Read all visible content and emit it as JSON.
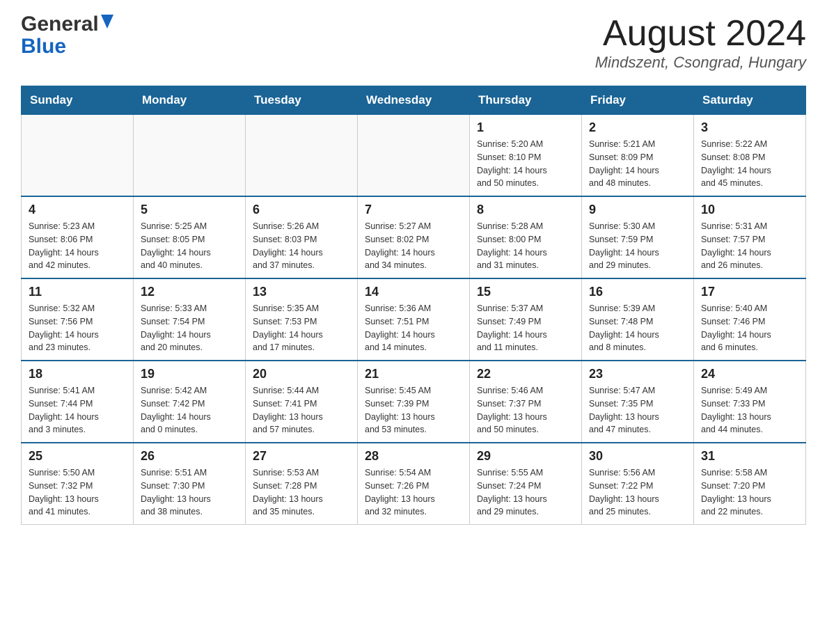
{
  "header": {
    "logo_general": "General",
    "logo_blue": "Blue",
    "month_title": "August 2024",
    "location": "Mindszent, Csongrad, Hungary"
  },
  "days_of_week": [
    "Sunday",
    "Monday",
    "Tuesday",
    "Wednesday",
    "Thursday",
    "Friday",
    "Saturday"
  ],
  "weeks": [
    [
      {
        "day": "",
        "info": ""
      },
      {
        "day": "",
        "info": ""
      },
      {
        "day": "",
        "info": ""
      },
      {
        "day": "",
        "info": ""
      },
      {
        "day": "1",
        "info": "Sunrise: 5:20 AM\nSunset: 8:10 PM\nDaylight: 14 hours\nand 50 minutes."
      },
      {
        "day": "2",
        "info": "Sunrise: 5:21 AM\nSunset: 8:09 PM\nDaylight: 14 hours\nand 48 minutes."
      },
      {
        "day": "3",
        "info": "Sunrise: 5:22 AM\nSunset: 8:08 PM\nDaylight: 14 hours\nand 45 minutes."
      }
    ],
    [
      {
        "day": "4",
        "info": "Sunrise: 5:23 AM\nSunset: 8:06 PM\nDaylight: 14 hours\nand 42 minutes."
      },
      {
        "day": "5",
        "info": "Sunrise: 5:25 AM\nSunset: 8:05 PM\nDaylight: 14 hours\nand 40 minutes."
      },
      {
        "day": "6",
        "info": "Sunrise: 5:26 AM\nSunset: 8:03 PM\nDaylight: 14 hours\nand 37 minutes."
      },
      {
        "day": "7",
        "info": "Sunrise: 5:27 AM\nSunset: 8:02 PM\nDaylight: 14 hours\nand 34 minutes."
      },
      {
        "day": "8",
        "info": "Sunrise: 5:28 AM\nSunset: 8:00 PM\nDaylight: 14 hours\nand 31 minutes."
      },
      {
        "day": "9",
        "info": "Sunrise: 5:30 AM\nSunset: 7:59 PM\nDaylight: 14 hours\nand 29 minutes."
      },
      {
        "day": "10",
        "info": "Sunrise: 5:31 AM\nSunset: 7:57 PM\nDaylight: 14 hours\nand 26 minutes."
      }
    ],
    [
      {
        "day": "11",
        "info": "Sunrise: 5:32 AM\nSunset: 7:56 PM\nDaylight: 14 hours\nand 23 minutes."
      },
      {
        "day": "12",
        "info": "Sunrise: 5:33 AM\nSunset: 7:54 PM\nDaylight: 14 hours\nand 20 minutes."
      },
      {
        "day": "13",
        "info": "Sunrise: 5:35 AM\nSunset: 7:53 PM\nDaylight: 14 hours\nand 17 minutes."
      },
      {
        "day": "14",
        "info": "Sunrise: 5:36 AM\nSunset: 7:51 PM\nDaylight: 14 hours\nand 14 minutes."
      },
      {
        "day": "15",
        "info": "Sunrise: 5:37 AM\nSunset: 7:49 PM\nDaylight: 14 hours\nand 11 minutes."
      },
      {
        "day": "16",
        "info": "Sunrise: 5:39 AM\nSunset: 7:48 PM\nDaylight: 14 hours\nand 8 minutes."
      },
      {
        "day": "17",
        "info": "Sunrise: 5:40 AM\nSunset: 7:46 PM\nDaylight: 14 hours\nand 6 minutes."
      }
    ],
    [
      {
        "day": "18",
        "info": "Sunrise: 5:41 AM\nSunset: 7:44 PM\nDaylight: 14 hours\nand 3 minutes."
      },
      {
        "day": "19",
        "info": "Sunrise: 5:42 AM\nSunset: 7:42 PM\nDaylight: 14 hours\nand 0 minutes."
      },
      {
        "day": "20",
        "info": "Sunrise: 5:44 AM\nSunset: 7:41 PM\nDaylight: 13 hours\nand 57 minutes."
      },
      {
        "day": "21",
        "info": "Sunrise: 5:45 AM\nSunset: 7:39 PM\nDaylight: 13 hours\nand 53 minutes."
      },
      {
        "day": "22",
        "info": "Sunrise: 5:46 AM\nSunset: 7:37 PM\nDaylight: 13 hours\nand 50 minutes."
      },
      {
        "day": "23",
        "info": "Sunrise: 5:47 AM\nSunset: 7:35 PM\nDaylight: 13 hours\nand 47 minutes."
      },
      {
        "day": "24",
        "info": "Sunrise: 5:49 AM\nSunset: 7:33 PM\nDaylight: 13 hours\nand 44 minutes."
      }
    ],
    [
      {
        "day": "25",
        "info": "Sunrise: 5:50 AM\nSunset: 7:32 PM\nDaylight: 13 hours\nand 41 minutes."
      },
      {
        "day": "26",
        "info": "Sunrise: 5:51 AM\nSunset: 7:30 PM\nDaylight: 13 hours\nand 38 minutes."
      },
      {
        "day": "27",
        "info": "Sunrise: 5:53 AM\nSunset: 7:28 PM\nDaylight: 13 hours\nand 35 minutes."
      },
      {
        "day": "28",
        "info": "Sunrise: 5:54 AM\nSunset: 7:26 PM\nDaylight: 13 hours\nand 32 minutes."
      },
      {
        "day": "29",
        "info": "Sunrise: 5:55 AM\nSunset: 7:24 PM\nDaylight: 13 hours\nand 29 minutes."
      },
      {
        "day": "30",
        "info": "Sunrise: 5:56 AM\nSunset: 7:22 PM\nDaylight: 13 hours\nand 25 minutes."
      },
      {
        "day": "31",
        "info": "Sunrise: 5:58 AM\nSunset: 7:20 PM\nDaylight: 13 hours\nand 22 minutes."
      }
    ]
  ]
}
